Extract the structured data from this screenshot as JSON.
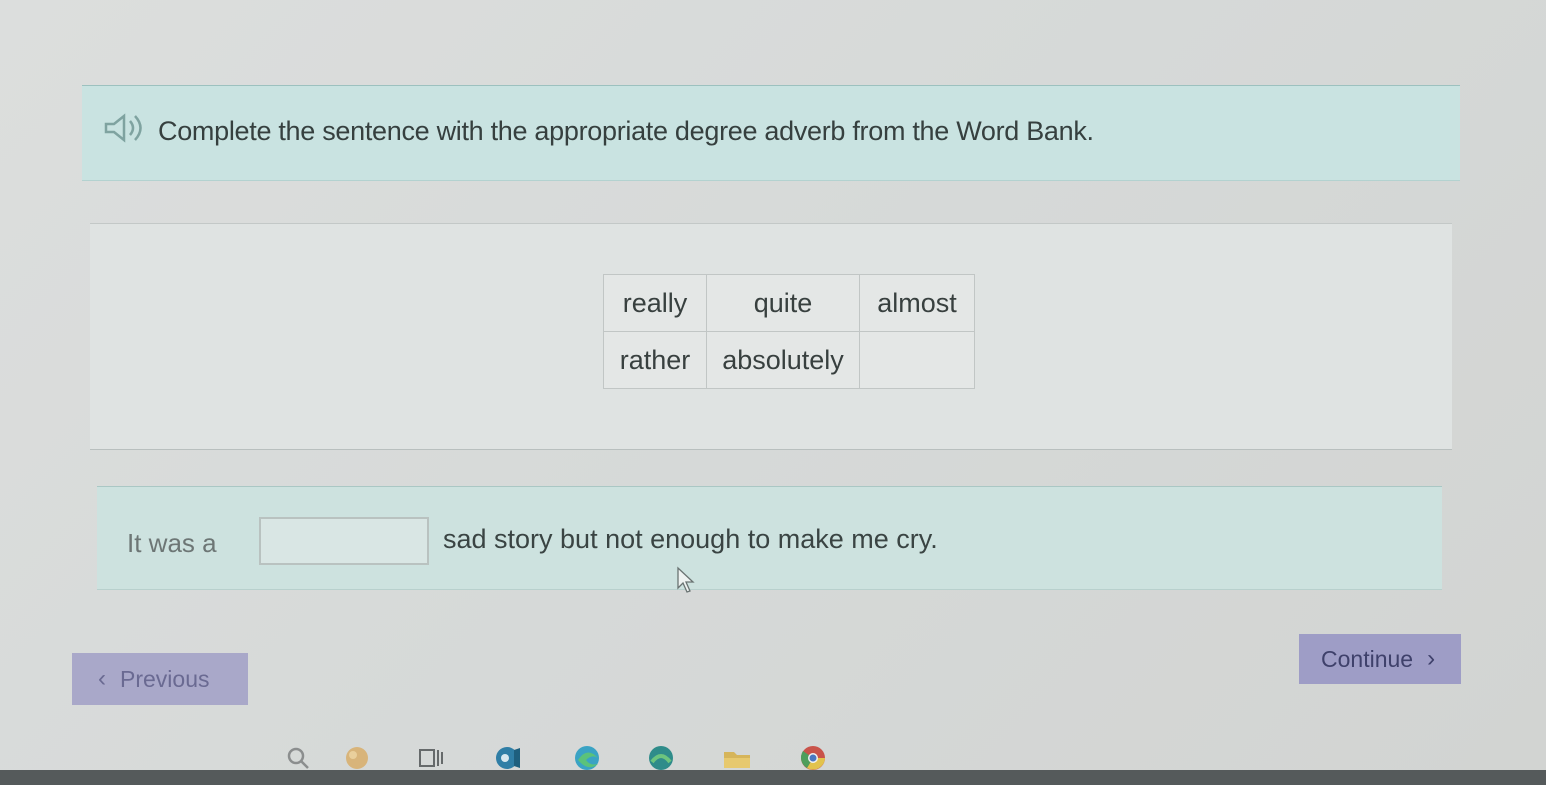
{
  "instruction": {
    "text": "Complete the sentence with the appropriate degree adverb from the Word Bank.",
    "icon": "speaker-icon"
  },
  "word_bank": {
    "rows": [
      [
        "really",
        "quite",
        "almost"
      ],
      [
        "rather",
        "absolutely",
        ""
      ]
    ]
  },
  "sentence": {
    "before": "It was a",
    "answer_value": "",
    "after": "sad story but not enough to make me cry."
  },
  "navigation": {
    "previous_label": "Previous",
    "continue_label": "Continue",
    "previous_icon": "chevron-left-icon",
    "continue_icon": "chevron-right-icon"
  },
  "colors": {
    "instruction_bg": "#c9e3e1",
    "sentence_bg": "#cde2df",
    "button_bg": "#9e9dc6"
  },
  "taskbar": {
    "icons": [
      "search-icon",
      "widgets-icon",
      "task-view-icon",
      "app-icon",
      "edge-icon",
      "teams-icon",
      "file-explorer-icon",
      "chrome-icon"
    ]
  }
}
